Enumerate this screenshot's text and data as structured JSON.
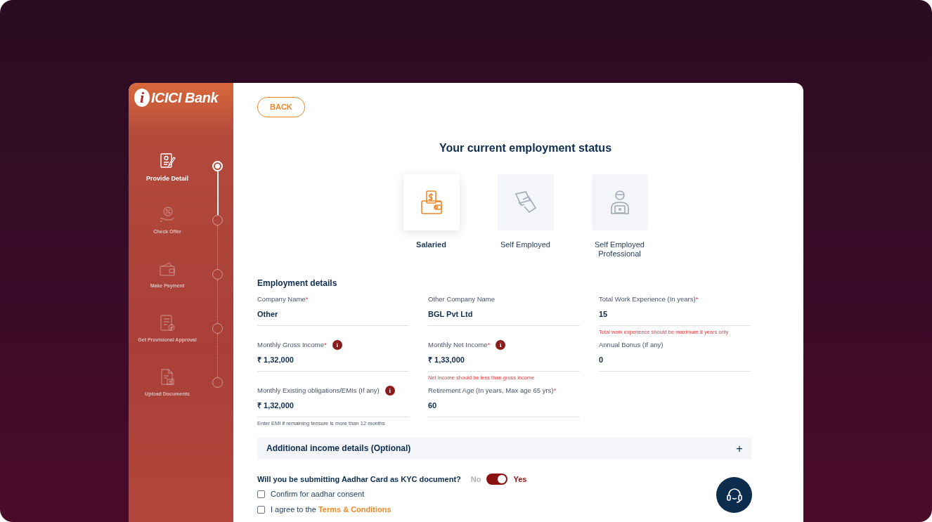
{
  "sidebar": {
    "logo": {
      "mark": "i",
      "name": "ICICI Bank"
    },
    "steps": [
      {
        "label": "Provide Detail",
        "selected": true
      },
      {
        "label": "Check Offer",
        "selected": false
      },
      {
        "label": "Make Payment",
        "selected": false
      },
      {
        "label": "Get Provisional Approval",
        "selected": false
      },
      {
        "label": "Upload Documents",
        "selected": false
      }
    ]
  },
  "back_button": "BACK",
  "title": "Your current employment status",
  "employment_options": [
    {
      "label": "Salaried",
      "selected": true
    },
    {
      "label": "Self Employed",
      "selected": false
    },
    {
      "label": "Self Employed Professional",
      "selected": false
    }
  ],
  "section_title": "Employment details",
  "fields": [
    {
      "label": "Company Name",
      "required_mark": "*",
      "value": "Other"
    },
    {
      "label": "Other Company Name",
      "value": "BGL Pvt Ltd"
    },
    {
      "label": "Total Work Experience (In years)",
      "required_mark": "*",
      "value": "15",
      "error": "Total work experience should be maximum 8 years only"
    },
    {
      "label": "Monthly Gross Income",
      "required_mark": "*",
      "info_icon": "i",
      "value": "₹ 1,32,000"
    },
    {
      "label": "Monthly Net Income",
      "required_mark": "*",
      "info_icon": "i",
      "value": "₹ 1,33,000",
      "error": "Net income should be less than gross income"
    },
    {
      "label": "Annual Bonus (If any)",
      "value": "0"
    },
    {
      "label": "Monthly Existing obligations/EMIs (If any)",
      "info_icon": "i",
      "value": "₹ 1,32,000",
      "hint": "Enter EMI if remaining tensure is more than 12 months"
    },
    {
      "label": "Retirement Age (In years, Max age 65 yrs)",
      "required_mark": "*",
      "value": "60"
    }
  ],
  "accordion": {
    "title": "Additional income details (Optional)",
    "expanded": false,
    "toggle": "+"
  },
  "kyc_question": {
    "text": "Will you be submitting Aadhar Card as KYC document?",
    "off_label": "No",
    "on_label": "Yes",
    "on": true
  },
  "checkboxes": [
    {
      "kind": "plain",
      "label": "Confirm for aadhar consent",
      "checked": false
    },
    {
      "kind": "link",
      "label": "I agree to the ",
      "link": "Terms & Conditions",
      "checked": false
    }
  ]
}
